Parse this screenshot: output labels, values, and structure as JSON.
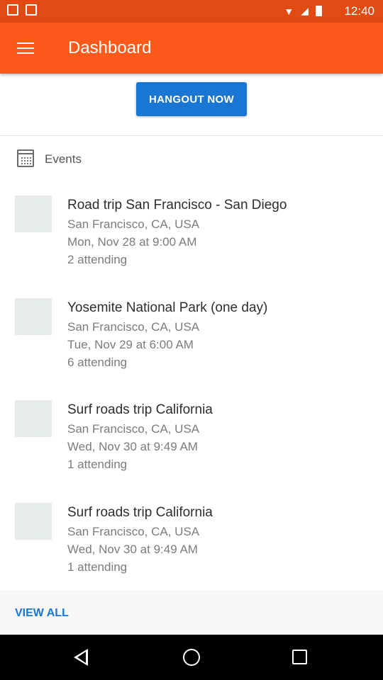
{
  "status_bar": {
    "time": "12:40"
  },
  "app_bar": {
    "title": "Dashboard",
    "menu_icon": "hamburger-menu-icon"
  },
  "hangout": {
    "button_label": "HANGOUT NOW"
  },
  "events": {
    "header_label": "Events",
    "header_icon": "calendar-icon",
    "items": [
      {
        "title": "Road trip San Francisco - San Diego",
        "location": "San Francisco, CA, USA",
        "datetime": "Mon, Nov 28 at 9:00 AM",
        "attending": "2 attending"
      },
      {
        "title": "Yosemite National Park (one day)",
        "location": "San Francisco, CA, USA",
        "datetime": "Tue, Nov 29 at 6:00 AM",
        "attending": "6 attending"
      },
      {
        "title": "Surf roads trip California",
        "location": "San Francisco, CA, USA",
        "datetime": "Wed, Nov 30 at 9:49 AM",
        "attending": "1 attending"
      },
      {
        "title": "Surf roads trip California",
        "location": "San Francisco, CA, USA",
        "datetime": "Wed, Nov 30 at 9:49 AM",
        "attending": "1 attending"
      }
    ]
  },
  "footer": {
    "view_all_label": "VIEW ALL"
  },
  "colors": {
    "status_bar": "#e24a13",
    "app_bar": "#fb5a1b",
    "accent": "#1976d2"
  }
}
